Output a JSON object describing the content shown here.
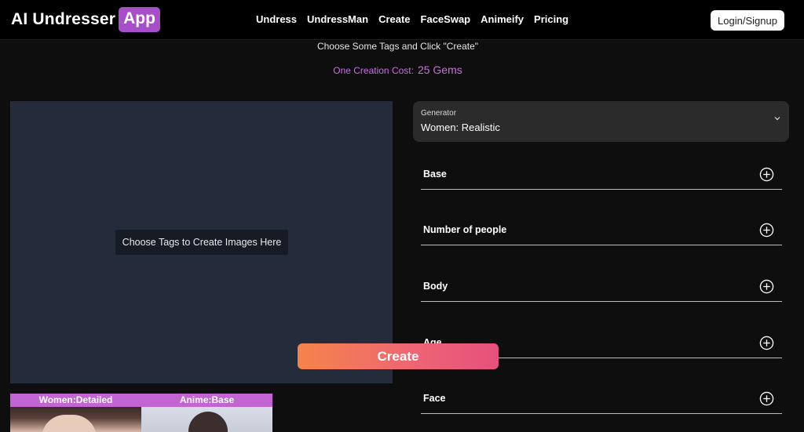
{
  "header": {
    "logo_text": "AI Undresser",
    "logo_badge": "App",
    "nav": [
      "Undress",
      "UndressMan",
      "Create",
      "FaceSwap",
      "Animeify",
      "Pricing"
    ],
    "login_label": "Login/Signup"
  },
  "intro": {
    "subtitle": "Choose Some Tags and Click \"Create\"",
    "cost_label": "One Creation Cost:",
    "cost_value": "25 Gems"
  },
  "canvas": {
    "hint": "Choose Tags to Create Images Here"
  },
  "create_label": "Create",
  "generator": {
    "label": "Generator",
    "value": "Women: Realistic"
  },
  "sections": [
    "Base",
    "Number of people",
    "Body",
    "Age",
    "Face"
  ],
  "thumbnails": [
    "Women:Detailed",
    "Anime:Base"
  ],
  "colors": {
    "accent_purple": "#a64fc9",
    "cost_purple": "#c86fe0",
    "create_gradient_start": "#f5844a",
    "create_gradient_end": "#e6507c",
    "canvas_bg": "#242b3a"
  },
  "icons": {
    "generator_dropdown": "chevron-down-icon",
    "section_expand": "plus-circle-icon"
  }
}
